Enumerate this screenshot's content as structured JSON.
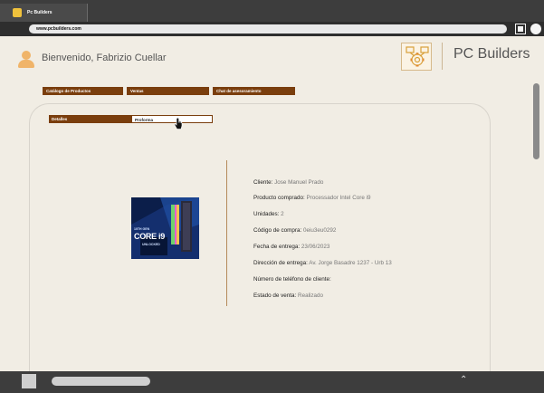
{
  "browser": {
    "tab_title": "Pc Builders",
    "url": "www.pcbuilders.com"
  },
  "header": {
    "welcome": "Bienvenido, Fabrizio Cuellar",
    "brand": "PC Builders"
  },
  "nav": [
    {
      "label": "Catálogo de Productos"
    },
    {
      "label": "Ventas"
    },
    {
      "label": "Chat de asesoramiento"
    }
  ],
  "subtabs": [
    {
      "label": "Detalles"
    },
    {
      "label": "Proforma"
    }
  ],
  "order": {
    "rows": [
      {
        "label": "Cliente:",
        "value": "Jose Manuel Prado"
      },
      {
        "label": "Producto comprado:",
        "value": "Processador Intel Core i9"
      },
      {
        "label": "Unidades:",
        "value": "2"
      },
      {
        "label": "Código de compra:",
        "value": "0eiu3eu0292"
      },
      {
        "label": "Fecha de entrega:",
        "value": "23/06/2023"
      },
      {
        "label": "Dirección de entrega:",
        "value": "Av. Jorge Basadre 1237 - Urb 13"
      },
      {
        "label": "Número de teléfono de cliente:",
        "value": ""
      },
      {
        "label": "Estado de venta:",
        "value": "Realizado"
      }
    ]
  },
  "product_image_text": {
    "line1": "10TH GEN",
    "line2": "CORE i9",
    "line3": "UNLOCKED"
  },
  "colors": {
    "accent": "#7a3e0d",
    "background": "#f1ede4"
  }
}
